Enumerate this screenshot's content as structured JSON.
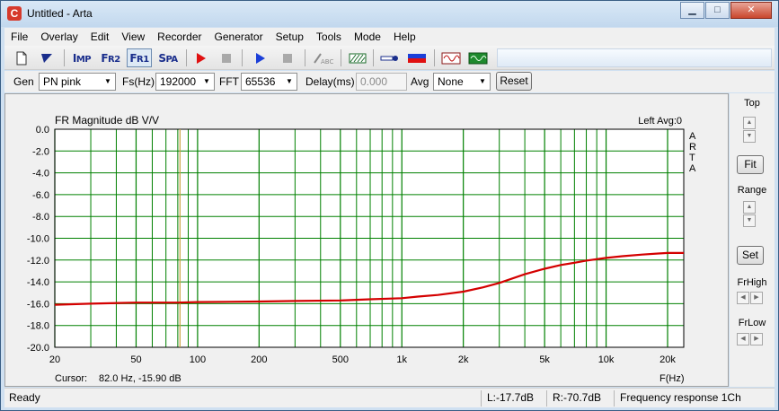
{
  "window": {
    "title": "Untitled - Arta",
    "app_icon_letter": "C",
    "minimize": "▁",
    "maximize": "□",
    "close": "✕"
  },
  "menu": [
    "File",
    "Overlay",
    "Edit",
    "View",
    "Recorder",
    "Generator",
    "Setup",
    "Tools",
    "Mode",
    "Help"
  ],
  "toolbar": {
    "imp": {
      "big": "I",
      "small": "MP"
    },
    "fr2": {
      "big": "F",
      "small": "R2"
    },
    "fr1": {
      "big": "F",
      "small": "R1"
    },
    "spa": {
      "big": "S",
      "small": "PA"
    },
    "abc": "ABC"
  },
  "options": {
    "gen_label": "Gen",
    "gen_value": "PN pink",
    "fs_label": "Fs(Hz)",
    "fs_value": "192000",
    "fft_label": "FFT",
    "fft_value": "65536",
    "delay_label": "Delay(ms)",
    "delay_value": "0.000",
    "avg_label": "Avg",
    "avg_value": "None",
    "reset_label": "Reset"
  },
  "plot": {
    "title": "FR Magnitude dB V/V",
    "status": "Left  Avg:0",
    "brand_letters": [
      "A",
      "R",
      "T",
      "A"
    ],
    "cursor_label": "Cursor:",
    "cursor_value": "82.0 Hz, -15.90 dB",
    "x_axis_label": "F(Hz)",
    "colors": {
      "grid": "#008000",
      "curve": "#d40000",
      "cursor": "#c8a040",
      "background": "#ffffff"
    }
  },
  "side": {
    "top_label": "Top",
    "fit_label": "Fit",
    "range_label": "Range",
    "set_label": "Set",
    "frhigh_label": "FrHigh",
    "frlow_label": "FrLow"
  },
  "status": {
    "ready": "Ready",
    "left_level": "L:-17.7dB",
    "right_level": "R:-70.7dB",
    "mode": "Frequency response 1Ch"
  },
  "chart_data": {
    "type": "line",
    "title": "FR Magnitude dB V/V",
    "xlabel": "F(Hz)",
    "ylabel": "",
    "xscale": "log",
    "xlim": [
      20,
      24000
    ],
    "ylim": [
      -20,
      0
    ],
    "grid": true,
    "x_ticks": [
      {
        "v": 20,
        "label": "20"
      },
      {
        "v": 50,
        "label": "50"
      },
      {
        "v": 100,
        "label": "100"
      },
      {
        "v": 200,
        "label": "200"
      },
      {
        "v": 500,
        "label": "500"
      },
      {
        "v": 1000,
        "label": "1k"
      },
      {
        "v": 2000,
        "label": "2k"
      },
      {
        "v": 5000,
        "label": "5k"
      },
      {
        "v": 10000,
        "label": "10k"
      },
      {
        "v": 20000,
        "label": "20k"
      }
    ],
    "y_ticks": [
      "0.0",
      "-2.0",
      "-4.0",
      "-6.0",
      "-8.0",
      "-10.0",
      "-12.0",
      "-14.0",
      "-16.0",
      "-18.0",
      "-20.0"
    ],
    "y_tick_values": [
      0,
      -2,
      -4,
      -6,
      -8,
      -10,
      -12,
      -14,
      -16,
      -18,
      -20
    ],
    "minor_x": [
      30,
      40,
      60,
      70,
      80,
      90,
      300,
      400,
      600,
      700,
      800,
      900,
      3000,
      4000,
      6000,
      7000,
      8000,
      9000
    ],
    "cursor": {
      "x": 82.0,
      "y": -15.9
    },
    "series": [
      {
        "x": [
          20,
          30,
          50,
          80,
          100,
          200,
          300,
          500,
          700,
          1000,
          1200,
          1500,
          2000,
          2500,
          3000,
          4000,
          5000,
          6000,
          7000,
          8000,
          10000,
          12000,
          15000,
          18000,
          20000,
          24000
        ],
        "y": [
          -16.1,
          -16.0,
          -15.9,
          -15.9,
          -15.85,
          -15.8,
          -15.75,
          -15.7,
          -15.6,
          -15.5,
          -15.35,
          -15.2,
          -14.9,
          -14.5,
          -14.1,
          -13.3,
          -12.8,
          -12.45,
          -12.25,
          -12.05,
          -11.8,
          -11.65,
          -11.5,
          -11.4,
          -11.35,
          -11.35
        ]
      }
    ]
  }
}
